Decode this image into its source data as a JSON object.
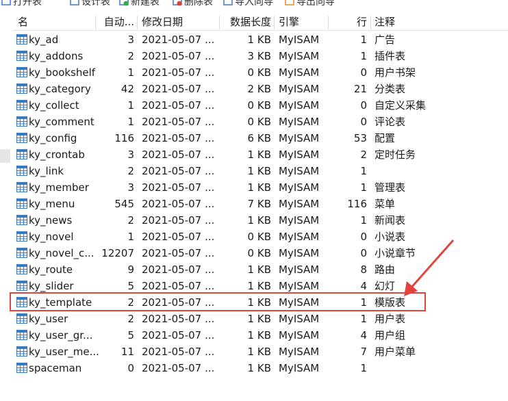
{
  "toolbar": {
    "items": [
      {
        "label": "打开表",
        "icon": "open-table-icon"
      },
      {
        "label": "设计表",
        "icon": "design-table-icon"
      },
      {
        "label": "新建表",
        "icon": "new-table-icon"
      },
      {
        "label": "删除表",
        "icon": "delete-table-icon"
      },
      {
        "label": "导入向导",
        "icon": "import-wizard-icon"
      },
      {
        "label": "导出向导",
        "icon": "export-wizard-icon"
      }
    ]
  },
  "table": {
    "columns": {
      "name": "名",
      "auto_increment": "自动...",
      "modified": "修改日期",
      "data_length": "数据长度",
      "engine": "引擎",
      "rows": "行",
      "comment": "注释"
    },
    "rows": [
      {
        "name": "ky_ad",
        "auto": "3",
        "modified": "2021-05-07 ...",
        "size": "1 KB",
        "engine": "MyISAM",
        "rows": "1",
        "comment": "广告"
      },
      {
        "name": "ky_addons",
        "auto": "2",
        "modified": "2021-05-07 ...",
        "size": "3 KB",
        "engine": "MyISAM",
        "rows": "1",
        "comment": "插件表"
      },
      {
        "name": "ky_bookshelf",
        "auto": "1",
        "modified": "2021-05-07 ...",
        "size": "0 KB",
        "engine": "MyISAM",
        "rows": "0",
        "comment": "用户书架"
      },
      {
        "name": "ky_category",
        "auto": "42",
        "modified": "2021-05-07 ...",
        "size": "2 KB",
        "engine": "MyISAM",
        "rows": "21",
        "comment": "分类表"
      },
      {
        "name": "ky_collect",
        "auto": "1",
        "modified": "2021-05-07 ...",
        "size": "0 KB",
        "engine": "MyISAM",
        "rows": "0",
        "comment": "自定义采集"
      },
      {
        "name": "ky_comment",
        "auto": "1",
        "modified": "2021-05-07 ...",
        "size": "0 KB",
        "engine": "MyISAM",
        "rows": "0",
        "comment": "评论表"
      },
      {
        "name": "ky_config",
        "auto": "116",
        "modified": "2021-05-07 ...",
        "size": "6 KB",
        "engine": "MyISAM",
        "rows": "53",
        "comment": "配置"
      },
      {
        "name": "ky_crontab",
        "auto": "3",
        "modified": "2021-05-07 ...",
        "size": "1 KB",
        "engine": "MyISAM",
        "rows": "2",
        "comment": "定时任务"
      },
      {
        "name": "ky_link",
        "auto": "2",
        "modified": "2021-05-07 ...",
        "size": "1 KB",
        "engine": "MyISAM",
        "rows": "1",
        "comment": ""
      },
      {
        "name": "ky_member",
        "auto": "3",
        "modified": "2021-05-07 ...",
        "size": "1 KB",
        "engine": "MyISAM",
        "rows": "1",
        "comment": "管理表"
      },
      {
        "name": "ky_menu",
        "auto": "545",
        "modified": "2021-05-07 ...",
        "size": "7 KB",
        "engine": "MyISAM",
        "rows": "116",
        "comment": "菜单"
      },
      {
        "name": "ky_news",
        "auto": "2",
        "modified": "2021-05-07 ...",
        "size": "1 KB",
        "engine": "MyISAM",
        "rows": "1",
        "comment": "新闻表"
      },
      {
        "name": "ky_novel",
        "auto": "1",
        "modified": "2021-05-07 ...",
        "size": "0 KB",
        "engine": "MyISAM",
        "rows": "0",
        "comment": "小说表"
      },
      {
        "name": "ky_novel_c...",
        "auto": "12207",
        "modified": "2021-05-07 ...",
        "size": "0 KB",
        "engine": "MyISAM",
        "rows": "0",
        "comment": "小说章节"
      },
      {
        "name": "ky_route",
        "auto": "9",
        "modified": "2021-05-07 ...",
        "size": "1 KB",
        "engine": "MyISAM",
        "rows": "8",
        "comment": "路由"
      },
      {
        "name": "ky_slider",
        "auto": "5",
        "modified": "2021-05-07 ...",
        "size": "1 KB",
        "engine": "MyISAM",
        "rows": "4",
        "comment": "幻灯"
      },
      {
        "name": "ky_template",
        "auto": "2",
        "modified": "2021-05-07 ...",
        "size": "1 KB",
        "engine": "MyISAM",
        "rows": "1",
        "comment": "模版表"
      },
      {
        "name": "ky_user",
        "auto": "2",
        "modified": "2021-05-07 ...",
        "size": "1 KB",
        "engine": "MyISAM",
        "rows": "1",
        "comment": "用户表"
      },
      {
        "name": "ky_user_gr...",
        "auto": "5",
        "modified": "2021-05-07 ...",
        "size": "1 KB",
        "engine": "MyISAM",
        "rows": "4",
        "comment": "用户组"
      },
      {
        "name": "ky_user_me...",
        "auto": "11",
        "modified": "2021-05-07 ...",
        "size": "1 KB",
        "engine": "MyISAM",
        "rows": "7",
        "comment": "用户菜单"
      },
      {
        "name": "spaceman",
        "auto": "0",
        "modified": "2021-05-07 ...",
        "size": "1 KB",
        "engine": "MyISAM",
        "rows": "1",
        "comment": ""
      }
    ]
  },
  "colors": {
    "annotation": "#e0443c",
    "table_icon": "#3a78c8"
  }
}
